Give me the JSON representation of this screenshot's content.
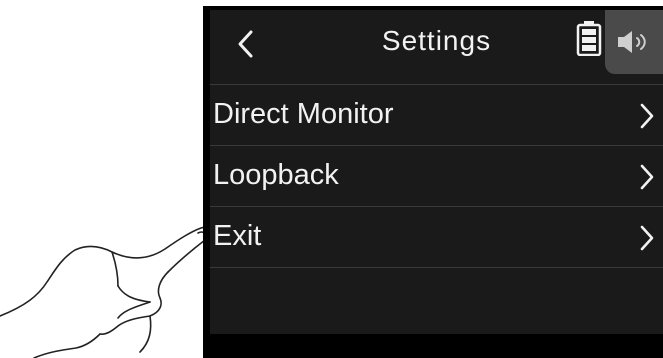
{
  "header": {
    "title": "Settings",
    "back_icon": "chevron-left-icon",
    "battery_icon": "battery-icon",
    "speaker_icon": "speaker-icon"
  },
  "menu": {
    "items": [
      {
        "label": "Direct Monitor",
        "icon": "chevron-right-icon"
      },
      {
        "label": "Loopback",
        "icon": "chevron-right-icon"
      },
      {
        "label": "Exit",
        "icon": "chevron-right-icon"
      }
    ]
  },
  "illustration": {
    "hand": "pointing-hand-icon"
  },
  "colors": {
    "screen_bg": "#1a1a1a",
    "bezel": "#000000",
    "divider": "#3a3a3a",
    "text": "#f2f2f2",
    "speaker_tab": "#4a4a4a"
  }
}
